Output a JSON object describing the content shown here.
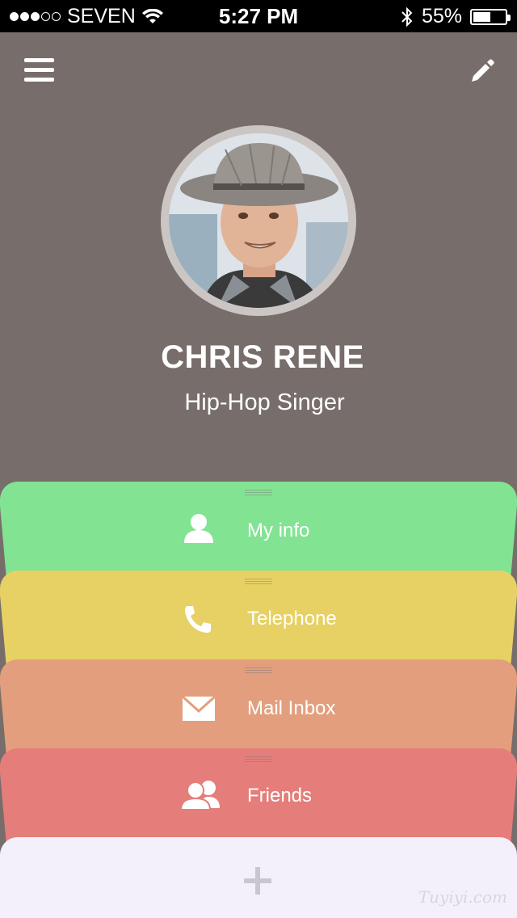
{
  "status_bar": {
    "carrier": "SEVEN",
    "time": "5:27 PM",
    "battery_percent": "55%",
    "battery_level": 0.55,
    "signal_dots_filled": 3,
    "signal_dots_total": 5
  },
  "header": {
    "menu_icon": "hamburger-menu",
    "edit_icon": "pencil"
  },
  "profile": {
    "name": "CHRIS RENE",
    "title": "Hip-Hop Singer"
  },
  "cards": [
    {
      "label": "My info",
      "icon": "person",
      "color": "#82e393"
    },
    {
      "label": "Telephone",
      "icon": "phone",
      "color": "#e7d165"
    },
    {
      "label": "Mail Inbox",
      "icon": "envelope",
      "color": "#e39f7d"
    },
    {
      "label": "Friends",
      "icon": "people",
      "color": "#e57e7b"
    }
  ],
  "add_panel": {
    "icon": "plus",
    "watermark": "Tuyiyi.com"
  }
}
